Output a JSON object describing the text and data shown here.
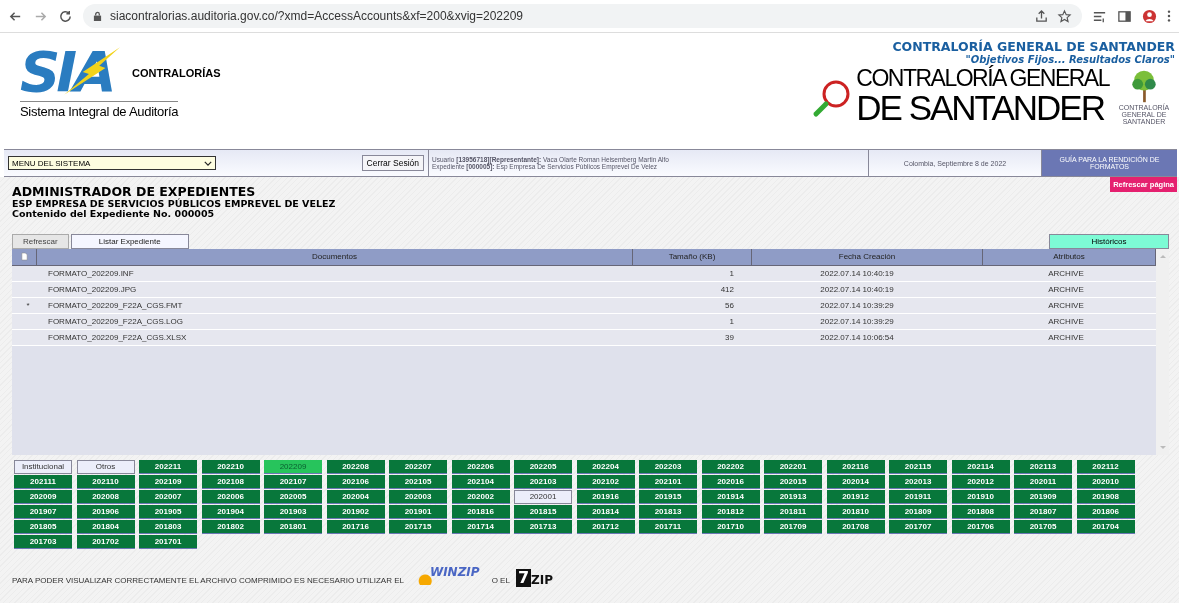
{
  "browser": {
    "url": "siacontralorias.auditoria.gov.co/?xmd=AccessAccounts&xf=200&xvig=202209"
  },
  "header": {
    "logo_mark": "SIA",
    "logo_word": "CONTRALORÍAS",
    "logo_subtitle": "Sistema Integral de Auditoría",
    "org_title": "CONTRALORÍA GENERAL DE SANTANDER",
    "org_motto": "\"Objetivos Fijos... Resultados Claros\"",
    "org_logo_line1": "CONTRALORÍA GENERAL",
    "org_logo_line2": "DE SANTANDER",
    "tree_caption": "CONTRALORÍA GENERAL DE SANTANDER"
  },
  "menu_bar": {
    "menu_select": "MENU DEL SISTEMA",
    "logout_button": "Cerrar Sesión",
    "user_line": "Usuario **[13956718][Representante]:** Vaca Olarte Roman Heisemberg Martin Alfo",
    "file_line": "Expediente **[000005]:** Esp Empresa De Servicios Públicos Emprevel De Velez",
    "date": "Colombia, Septiembre 8 de 2022",
    "guide_button": "GUÍA PARA LA RENDICIÓN DE FORMATOS"
  },
  "refresh_page_button": "Refrescar página",
  "title": "ADMINISTRADOR DE EXPEDIENTES",
  "company": "ESP EMPRESA DE SERVICIOS PÚBLICOS EMPREVEL DE VELEZ",
  "subtitle": "Contenido del Expediente No. 000005",
  "tabs": [
    {
      "label": "Refrescar",
      "selected": false
    },
    {
      "label": "Listar Expediente",
      "selected": true
    }
  ],
  "history_button": "Históricos",
  "table": {
    "columns": [
      "Documentos",
      "Tamaño (KB)",
      "Fecha Creación",
      "Atributos"
    ],
    "rows": [
      {
        "marker": "",
        "name": "FORMATO_202209.INF",
        "size": "1",
        "created": "2022.07.14 10:40:19",
        "attributes": "ARCHIVE"
      },
      {
        "marker": "",
        "name": "FORMATO_202209.JPG",
        "size": "412",
        "created": "2022.07.14 10:40:19",
        "attributes": "ARCHIVE"
      },
      {
        "marker": "*",
        "name": "FORMATO_202209_F22A_CGS.FMT",
        "size": "56",
        "created": "2022.07.14 10:39:29",
        "attributes": "ARCHIVE"
      },
      {
        "marker": "",
        "name": "FORMATO_202209_F22A_CGS.LOG",
        "size": "1",
        "created": "2022.07.14 10:39:29",
        "attributes": "ARCHIVE"
      },
      {
        "marker": "",
        "name": "FORMATO_202209_F22A_CGS.XLSX",
        "size": "39",
        "created": "2022.07.14 10:06:54",
        "attributes": "ARCHIVE"
      }
    ]
  },
  "periods": [
    {
      "label": "Institucional",
      "kind": "light",
      "selected": false
    },
    {
      "label": "Otros",
      "kind": "light",
      "selected": false
    },
    {
      "label": "202211",
      "kind": "dark",
      "selected": false
    },
    {
      "label": "202210",
      "kind": "dark",
      "selected": false
    },
    {
      "label": "202209",
      "kind": "dark",
      "selected": true
    },
    {
      "label": "202208",
      "kind": "dark",
      "selected": false
    },
    {
      "label": "202207",
      "kind": "dark",
      "selected": false
    },
    {
      "label": "202206",
      "kind": "dark",
      "selected": false
    },
    {
      "label": "202205",
      "kind": "dark",
      "selected": false
    },
    {
      "label": "202204",
      "kind": "dark",
      "selected": false
    },
    {
      "label": "202203",
      "kind": "dark",
      "selected": false
    },
    {
      "label": "202202",
      "kind": "dark",
      "selected": false
    },
    {
      "label": "202201",
      "kind": "dark",
      "selected": false
    },
    {
      "label": "202116",
      "kind": "dark",
      "selected": false
    },
    {
      "label": "202115",
      "kind": "dark",
      "selected": false
    },
    {
      "label": "202114",
      "kind": "dark",
      "selected": false
    },
    {
      "label": "202113",
      "kind": "dark",
      "selected": false
    },
    {
      "label": "202112",
      "kind": "dark",
      "selected": false
    },
    {
      "label": "202111",
      "kind": "dark",
      "selected": false
    },
    {
      "label": "202110",
      "kind": "dark",
      "selected": false
    },
    {
      "label": "202109",
      "kind": "dark",
      "selected": false
    },
    {
      "label": "202108",
      "kind": "dark",
      "selected": false
    },
    {
      "label": "202107",
      "kind": "dark",
      "selected": false
    },
    {
      "label": "202106",
      "kind": "dark",
      "selected": false
    },
    {
      "label": "202105",
      "kind": "dark",
      "selected": false
    },
    {
      "label": "202104",
      "kind": "dark",
      "selected": false
    },
    {
      "label": "202103",
      "kind": "dark",
      "selected": false
    },
    {
      "label": "202102",
      "kind": "dark",
      "selected": false
    },
    {
      "label": "202101",
      "kind": "dark",
      "selected": false
    },
    {
      "label": "202016",
      "kind": "dark",
      "selected": false
    },
    {
      "label": "202015",
      "kind": "dark",
      "selected": false
    },
    {
      "label": "202014",
      "kind": "dark",
      "selected": false
    },
    {
      "label": "202013",
      "kind": "dark",
      "selected": false
    },
    {
      "label": "202012",
      "kind": "dark",
      "selected": false
    },
    {
      "label": "202011",
      "kind": "dark",
      "selected": false
    },
    {
      "label": "202010",
      "kind": "dark",
      "selected": false
    },
    {
      "label": "202009",
      "kind": "dark",
      "selected": false
    },
    {
      "label": "202008",
      "kind": "dark",
      "selected": false
    },
    {
      "label": "202007",
      "kind": "dark",
      "selected": false
    },
    {
      "label": "202006",
      "kind": "dark",
      "selected": false
    },
    {
      "label": "202005",
      "kind": "dark",
      "selected": false
    },
    {
      "label": "202004",
      "kind": "dark",
      "selected": false
    },
    {
      "label": "202003",
      "kind": "dark",
      "selected": false
    },
    {
      "label": "202002",
      "kind": "dark",
      "selected": false
    },
    {
      "label": "202001",
      "kind": "light",
      "selected": false
    },
    {
      "label": "201916",
      "kind": "dark",
      "selected": false
    },
    {
      "label": "201915",
      "kind": "dark",
      "selected": false
    },
    {
      "label": "201914",
      "kind": "dark",
      "selected": false
    },
    {
      "label": "201913",
      "kind": "dark",
      "selected": false
    },
    {
      "label": "201912",
      "kind": "dark",
      "selected": false
    },
    {
      "label": "201911",
      "kind": "dark",
      "selected": false
    },
    {
      "label": "201910",
      "kind": "dark",
      "selected": false
    },
    {
      "label": "201909",
      "kind": "dark",
      "selected": false
    },
    {
      "label": "201908",
      "kind": "dark",
      "selected": false
    },
    {
      "label": "201907",
      "kind": "dark",
      "selected": false
    },
    {
      "label": "201906",
      "kind": "dark",
      "selected": false
    },
    {
      "label": "201905",
      "kind": "dark",
      "selected": false
    },
    {
      "label": "201904",
      "kind": "dark",
      "selected": false
    },
    {
      "label": "201903",
      "kind": "dark",
      "selected": false
    },
    {
      "label": "201902",
      "kind": "dark",
      "selected": false
    },
    {
      "label": "201901",
      "kind": "dark",
      "selected": false
    },
    {
      "label": "201816",
      "kind": "dark",
      "selected": false
    },
    {
      "label": "201815",
      "kind": "dark",
      "selected": false
    },
    {
      "label": "201814",
      "kind": "dark",
      "selected": false
    },
    {
      "label": "201813",
      "kind": "dark",
      "selected": false
    },
    {
      "label": "201812",
      "kind": "dark",
      "selected": false
    },
    {
      "label": "201811",
      "kind": "dark",
      "selected": false
    },
    {
      "label": "201810",
      "kind": "dark",
      "selected": false
    },
    {
      "label": "201809",
      "kind": "dark",
      "selected": false
    },
    {
      "label": "201808",
      "kind": "dark",
      "selected": false
    },
    {
      "label": "201807",
      "kind": "dark",
      "selected": false
    },
    {
      "label": "201806",
      "kind": "dark",
      "selected": false
    },
    {
      "label": "201805",
      "kind": "dark",
      "selected": false
    },
    {
      "label": "201804",
      "kind": "dark",
      "selected": false
    },
    {
      "label": "201803",
      "kind": "dark",
      "selected": false
    },
    {
      "label": "201802",
      "kind": "dark",
      "selected": false
    },
    {
      "label": "201801",
      "kind": "dark",
      "selected": false
    },
    {
      "label": "201716",
      "kind": "dark",
      "selected": false
    },
    {
      "label": "201715",
      "kind": "dark",
      "selected": false
    },
    {
      "label": "201714",
      "kind": "dark",
      "selected": false
    },
    {
      "label": "201713",
      "kind": "dark",
      "selected": false
    },
    {
      "label": "201712",
      "kind": "dark",
      "selected": false
    },
    {
      "label": "201711",
      "kind": "dark",
      "selected": false
    },
    {
      "label": "201710",
      "kind": "dark",
      "selected": false
    },
    {
      "label": "201709",
      "kind": "dark",
      "selected": false
    },
    {
      "label": "201708",
      "kind": "dark",
      "selected": false
    },
    {
      "label": "201707",
      "kind": "dark",
      "selected": false
    },
    {
      "label": "201706",
      "kind": "dark",
      "selected": false
    },
    {
      "label": "201705",
      "kind": "dark",
      "selected": false
    },
    {
      "label": "201704",
      "kind": "dark",
      "selected": false
    },
    {
      "label": "201703",
      "kind": "dark",
      "selected": false
    },
    {
      "label": "201702",
      "kind": "dark",
      "selected": false
    },
    {
      "label": "201701",
      "kind": "dark",
      "selected": false
    }
  ],
  "footer": {
    "notice": "PARA PODER VISUALIZAR CORRECTAMENTE EL ARCHIVO COMPRIMIDO ES NECESARIO UTILIZAR EL",
    "winzip": "WINZIP",
    "connector": "O EL",
    "sevenzip_digit": "7",
    "sevenzip_word": "ZIP"
  }
}
